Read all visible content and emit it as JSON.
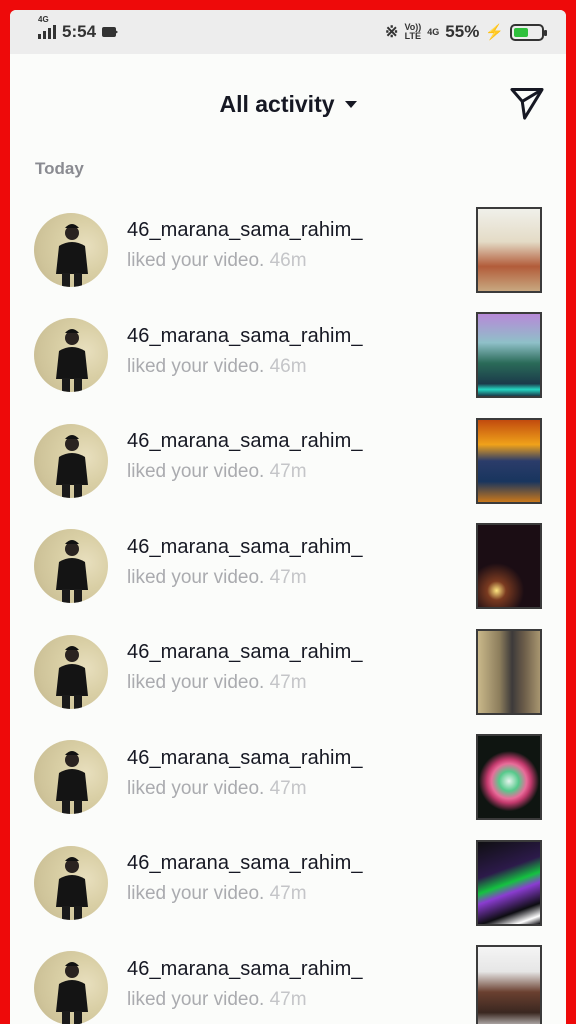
{
  "status_bar": {
    "network": "4G",
    "time": "5:54",
    "volte": "Vo))",
    "lte": "LTE",
    "data_net": "4G",
    "battery": "55%",
    "battery_level": 0.55,
    "colors": {
      "battery_fill": "#2fc03c",
      "charging": "#f0b400"
    }
  },
  "header": {
    "title": "All activity",
    "dropdown_icon": "caret-down-icon",
    "inbox_icon": "send-icon"
  },
  "section": {
    "label": "Today"
  },
  "notifications": [
    {
      "username": "46_marana_sama_rahim_",
      "action": "liked your video.",
      "time": "46m"
    },
    {
      "username": "46_marana_sama_rahim_",
      "action": "liked your video.",
      "time": "46m"
    },
    {
      "username": "46_marana_sama_rahim_",
      "action": "liked your video.",
      "time": "47m"
    },
    {
      "username": "46_marana_sama_rahim_",
      "action": "liked your video.",
      "time": "47m"
    },
    {
      "username": "46_marana_sama_rahim_",
      "action": "liked your video.",
      "time": "47m"
    },
    {
      "username": "46_marana_sama_rahim_",
      "action": "liked your video.",
      "time": "47m"
    },
    {
      "username": "46_marana_sama_rahim_",
      "action": "liked your video.",
      "time": "47m"
    },
    {
      "username": "46_marana_sama_rahim_",
      "action": "liked your video.",
      "time": "47m"
    }
  ],
  "colors": {
    "frame": "#ee0a0a",
    "background": "#fbfcfa",
    "primary_text": "#161823",
    "secondary_text": "#aaabaf"
  }
}
